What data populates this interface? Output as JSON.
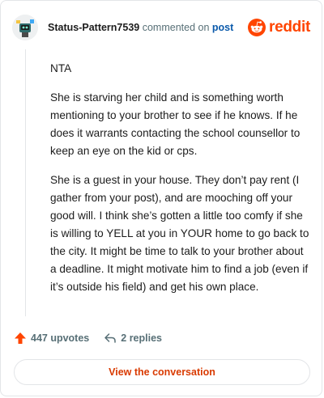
{
  "comment": {
    "username": "Status-Pattern7539",
    "action": "commented on",
    "target": "post",
    "paragraphs": [
      "NTA",
      "She is starving her child and is something worth mentioning to your brother to see if he knows. If he does it warrants contacting the school counsellor to keep an eye on the kid or cps.",
      "She is a guest in your house. They don’t pay rent (I gather from your post), and are mooching off your good will. I think she’s gotten a little too comfy if she is willing to YELL at you in YOUR home to go back to the city. It might be time to talk to your brother about a deadline. It might motivate him to find a job (even if it’s outside his field) and get his own place."
    ]
  },
  "brand": {
    "wordmark": "reddit",
    "icon": "reddit-snoo-icon",
    "color": "#ff4500"
  },
  "stats": {
    "upvotes": "447 upvotes",
    "replies": "2 replies",
    "upvote_icon": "upvote-arrow-icon",
    "reply_icon": "reply-arrow-icon",
    "upvote_color": "#ff4500"
  },
  "cta": {
    "label": "View the conversation",
    "color": "#d93a00"
  }
}
